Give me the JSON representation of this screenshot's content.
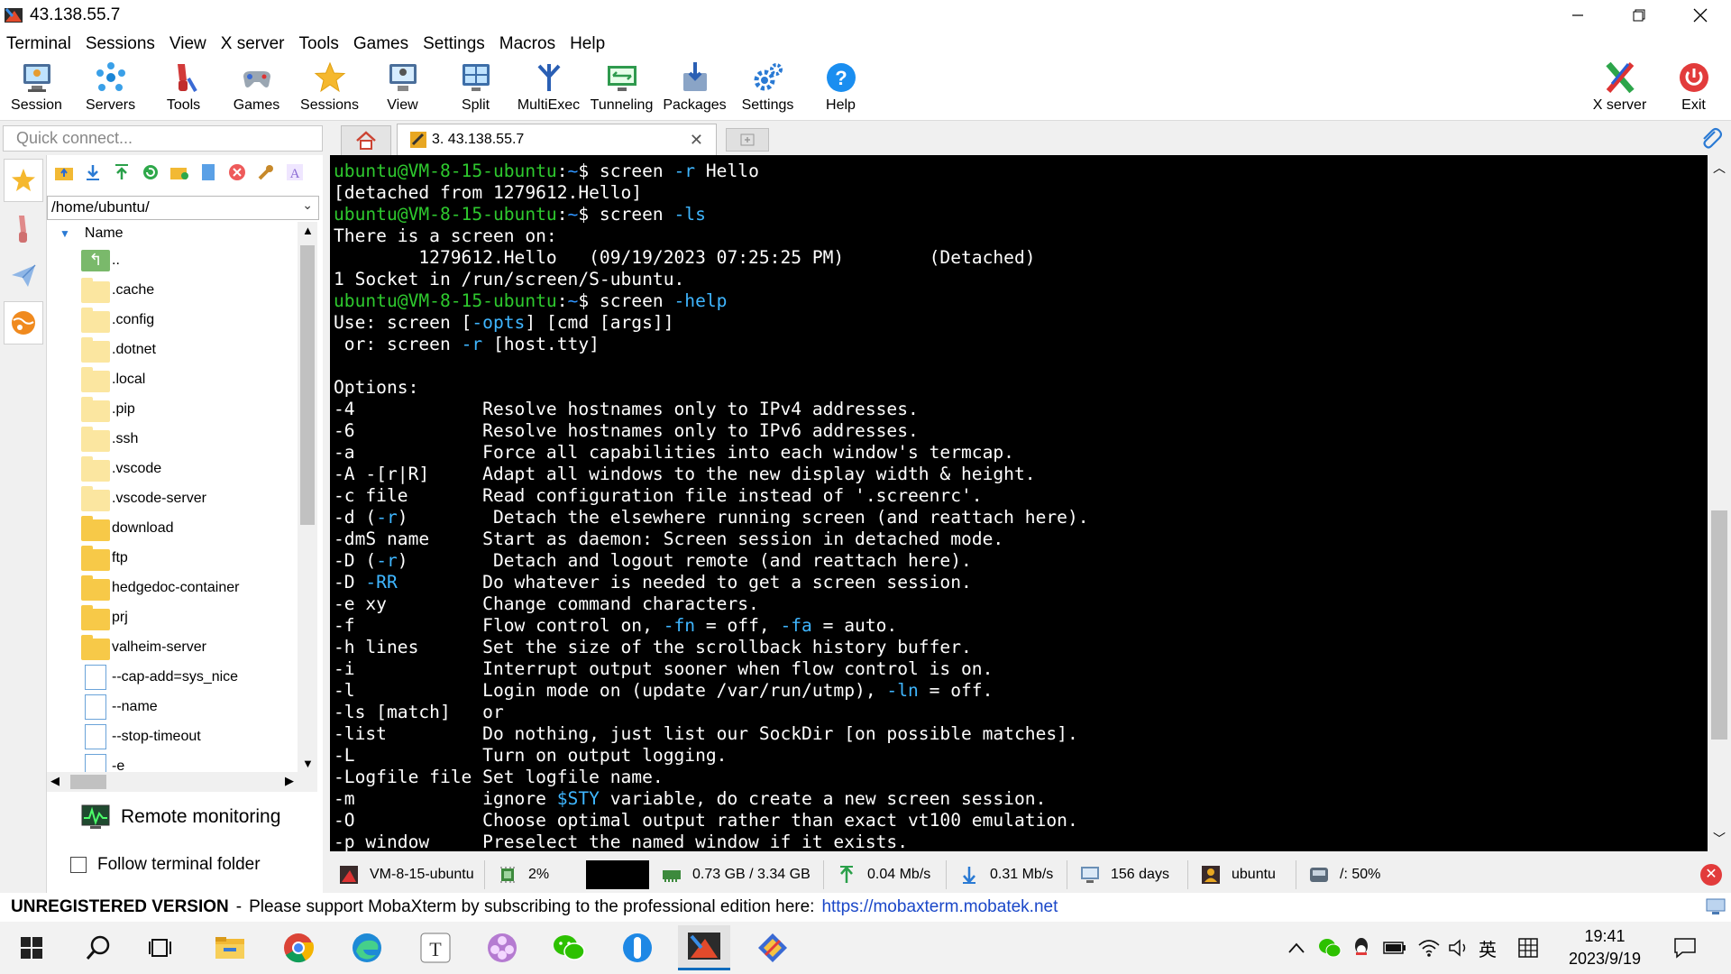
{
  "window": {
    "title": "43.138.55.7"
  },
  "menu": [
    "Terminal",
    "Sessions",
    "View",
    "X server",
    "Tools",
    "Games",
    "Settings",
    "Macros",
    "Help"
  ],
  "toolbar": {
    "session": "Session",
    "servers": "Servers",
    "tools": "Tools",
    "games": "Games",
    "sessions": "Sessions",
    "view": "View",
    "split": "Split",
    "multiexec": "MultiExec",
    "tunneling": "Tunneling",
    "packages": "Packages",
    "settings": "Settings",
    "help": "Help",
    "xserver": "X server",
    "exit": "Exit"
  },
  "quick_connect": {
    "placeholder": "Quick connect..."
  },
  "tabs": {
    "session_tab": "3. 43.138.55.7"
  },
  "sftp": {
    "path": "/home/ubuntu/",
    "column": "Name",
    "items": [
      {
        "name": "..",
        "type": "up"
      },
      {
        "name": ".cache",
        "type": "folder-light"
      },
      {
        "name": ".config",
        "type": "folder-light"
      },
      {
        "name": ".dotnet",
        "type": "folder-light"
      },
      {
        "name": ".local",
        "type": "folder-light"
      },
      {
        "name": ".pip",
        "type": "folder-light"
      },
      {
        "name": ".ssh",
        "type": "folder-light"
      },
      {
        "name": ".vscode",
        "type": "folder-light"
      },
      {
        "name": ".vscode-server",
        "type": "folder-light"
      },
      {
        "name": "download",
        "type": "folder"
      },
      {
        "name": "ftp",
        "type": "folder"
      },
      {
        "name": "hedgedoc-container",
        "type": "folder"
      },
      {
        "name": "prj",
        "type": "folder"
      },
      {
        "name": "valheim-server",
        "type": "folder"
      },
      {
        "name": "--cap-add=sys_nice",
        "type": "file"
      },
      {
        "name": "--name",
        "type": "file"
      },
      {
        "name": "--stop-timeout",
        "type": "file"
      },
      {
        "name": "-e",
        "type": "file"
      }
    ],
    "remote_monitoring": "Remote monitoring",
    "follow_folder": "Follow terminal folder"
  },
  "terminal": {
    "lines": [
      [
        {
          "t": "ubuntu@VM-8-15-ubuntu",
          "c": "g"
        },
        {
          "t": ":",
          "c": ""
        },
        {
          "t": "~",
          "c": "b"
        },
        {
          "t": "$ screen ",
          "c": ""
        },
        {
          "t": "-r",
          "c": "c"
        },
        {
          "t": " Hello",
          "c": ""
        }
      ],
      [
        {
          "t": "[detached from 1279612.Hello]",
          "c": ""
        }
      ],
      [
        {
          "t": "ubuntu@VM-8-15-ubuntu",
          "c": "g"
        },
        {
          "t": ":",
          "c": ""
        },
        {
          "t": "~",
          "c": "b"
        },
        {
          "t": "$ screen ",
          "c": ""
        },
        {
          "t": "-ls",
          "c": "c"
        }
      ],
      [
        {
          "t": "There is a screen on:",
          "c": ""
        }
      ],
      [
        {
          "t": "        1279612.Hello   (09/19/2023 07:25:25 PM)        (Detached)",
          "c": ""
        }
      ],
      [
        {
          "t": "1 Socket in /run/screen/S-ubuntu.",
          "c": ""
        }
      ],
      [
        {
          "t": "ubuntu@VM-8-15-ubuntu",
          "c": "g"
        },
        {
          "t": ":",
          "c": ""
        },
        {
          "t": "~",
          "c": "b"
        },
        {
          "t": "$ screen ",
          "c": ""
        },
        {
          "t": "-help",
          "c": "c"
        }
      ],
      [
        {
          "t": "Use: screen [",
          "c": ""
        },
        {
          "t": "-opts",
          "c": "c"
        },
        {
          "t": "] [cmd [args]]",
          "c": ""
        }
      ],
      [
        {
          "t": " or: screen ",
          "c": ""
        },
        {
          "t": "-r",
          "c": "c"
        },
        {
          "t": " [host.tty]",
          "c": ""
        }
      ],
      [
        {
          "t": "",
          "c": ""
        }
      ],
      [
        {
          "t": "Options:",
          "c": ""
        }
      ],
      [
        {
          "t": "-4            Resolve hostnames only to IPv4 addresses.",
          "c": ""
        }
      ],
      [
        {
          "t": "-6            Resolve hostnames only to IPv6 addresses.",
          "c": ""
        }
      ],
      [
        {
          "t": "-a            Force all capabilities into each window's termcap.",
          "c": ""
        }
      ],
      [
        {
          "t": "-A -[r|R]     Adapt all windows to the new display width & height.",
          "c": ""
        }
      ],
      [
        {
          "t": "-c file       Read configuration file instead of '.screenrc'.",
          "c": ""
        }
      ],
      [
        {
          "t": "-d (",
          "c": ""
        },
        {
          "t": "-r",
          "c": "c"
        },
        {
          "t": ")        Detach the elsewhere running screen (and reattach here).",
          "c": ""
        }
      ],
      [
        {
          "t": "-dmS name     Start as daemon: Screen session in detached mode.",
          "c": ""
        }
      ],
      [
        {
          "t": "-D (",
          "c": ""
        },
        {
          "t": "-r",
          "c": "c"
        },
        {
          "t": ")        Detach and logout remote (and reattach here).",
          "c": ""
        }
      ],
      [
        {
          "t": "-D ",
          "c": ""
        },
        {
          "t": "-RR",
          "c": "c"
        },
        {
          "t": "        Do whatever is needed to get a screen session.",
          "c": ""
        }
      ],
      [
        {
          "t": "-e xy         Change command characters.",
          "c": ""
        }
      ],
      [
        {
          "t": "-f            Flow control on, ",
          "c": ""
        },
        {
          "t": "-fn",
          "c": "c"
        },
        {
          "t": " = off, ",
          "c": ""
        },
        {
          "t": "-fa",
          "c": "c"
        },
        {
          "t": " = auto.",
          "c": ""
        }
      ],
      [
        {
          "t": "-h lines      Set the size of the scrollback history buffer.",
          "c": ""
        }
      ],
      [
        {
          "t": "-i            Interrupt output sooner when flow control is on.",
          "c": ""
        }
      ],
      [
        {
          "t": "-l            Login mode on (update /var/run/utmp), ",
          "c": ""
        },
        {
          "t": "-ln",
          "c": "c"
        },
        {
          "t": " = off.",
          "c": ""
        }
      ],
      [
        {
          "t": "-ls [match]   or",
          "c": ""
        }
      ],
      [
        {
          "t": "-list         Do nothing, just list our SockDir [on possible matches].",
          "c": ""
        }
      ],
      [
        {
          "t": "-L            Turn on output logging.",
          "c": ""
        }
      ],
      [
        {
          "t": "-Logfile file Set logfile name.",
          "c": ""
        }
      ],
      [
        {
          "t": "-m            ignore ",
          "c": ""
        },
        {
          "t": "$STY",
          "c": "c"
        },
        {
          "t": " variable, do create a new screen session.",
          "c": ""
        }
      ],
      [
        {
          "t": "-O            Choose optimal output rather than exact vt100 emulation.",
          "c": ""
        }
      ],
      [
        {
          "t": "-p window     Preselect the named window if it exists.",
          "c": ""
        }
      ]
    ]
  },
  "status": {
    "host": "VM-8-15-ubuntu",
    "cpu": "2%",
    "memory": "0.73 GB / 3.34 GB",
    "upload": "0.04 Mb/s",
    "download": "0.31 Mb/s",
    "uptime": "156 days",
    "user": "ubuntu",
    "disk": "/: 50%"
  },
  "unregistered": {
    "label": "UNREGISTERED VERSION",
    "sep": "-",
    "message": "Please support MobaXterm by subscribing to the professional edition here:",
    "link": "https://mobaxterm.mobatek.net"
  },
  "taskbar": {
    "ime": "英",
    "time": "19:41",
    "date": "2023/9/19"
  }
}
